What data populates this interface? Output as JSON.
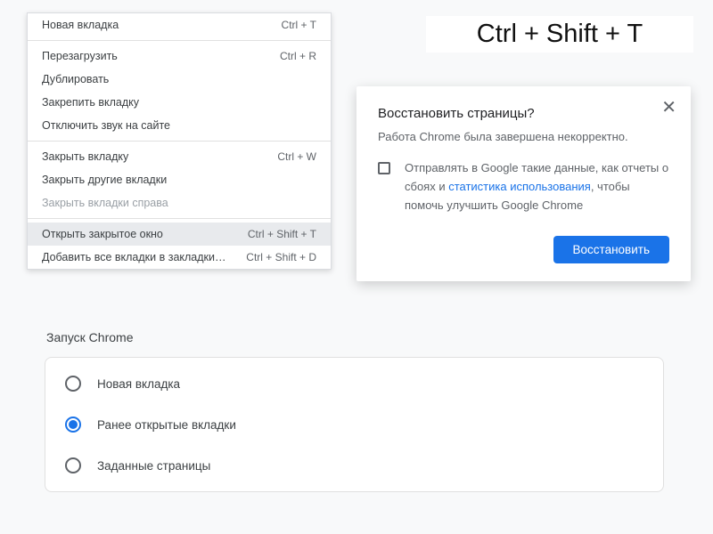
{
  "big_shortcut": "Ctrl + Shift + T",
  "context_menu": {
    "groups": [
      [
        {
          "label": "Новая вкладка",
          "shortcut": "Ctrl + T",
          "disabled": false
        }
      ],
      [
        {
          "label": "Перезагрузить",
          "shortcut": "Ctrl + R",
          "disabled": false
        },
        {
          "label": "Дублировать",
          "shortcut": "",
          "disabled": false
        },
        {
          "label": "Закрепить вкладку",
          "shortcut": "",
          "disabled": false
        },
        {
          "label": "Отключить звук на сайте",
          "shortcut": "",
          "disabled": false
        }
      ],
      [
        {
          "label": "Закрыть вкладку",
          "shortcut": "Ctrl + W",
          "disabled": false
        },
        {
          "label": "Закрыть другие вкладки",
          "shortcut": "",
          "disabled": false
        },
        {
          "label": "Закрыть вкладки справа",
          "shortcut": "",
          "disabled": true
        }
      ],
      [
        {
          "label": "Открыть закрытое окно",
          "shortcut": "Ctrl + Shift + T",
          "disabled": false,
          "highlighted": true
        },
        {
          "label": "Добавить все вкладки в закладки…",
          "shortcut": "Ctrl + Shift + D",
          "disabled": false
        }
      ]
    ]
  },
  "restore_dialog": {
    "title": "Восстановить страницы?",
    "subtitle": "Работа Chrome была завершена некорректно.",
    "checkbox_text_before": "Отправлять в Google такие данные, как отчеты о сбоях и ",
    "checkbox_link": "статистика использования",
    "checkbox_text_after": ", чтобы помочь улучшить Google Chrome",
    "button": "Восстановить"
  },
  "settings": {
    "title": "Запуск Chrome",
    "options": [
      {
        "label": "Новая вкладка",
        "selected": false
      },
      {
        "label": "Ранее открытые вкладки",
        "selected": true
      },
      {
        "label": "Заданные страницы",
        "selected": false
      }
    ]
  }
}
